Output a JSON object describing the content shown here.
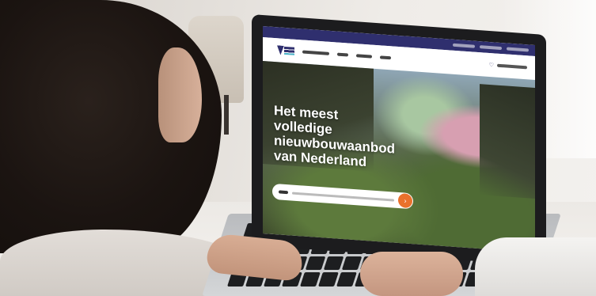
{
  "hero": {
    "title": "Het meest volledige nieuwbouwaanbod van Nederland"
  },
  "icons": {
    "logo": "logo-icon",
    "favorites": "heart-icon",
    "search_submit": "arrow-right-icon"
  },
  "colors": {
    "brand_navy": "#2f2f6e",
    "search_button": "#e9712c"
  }
}
